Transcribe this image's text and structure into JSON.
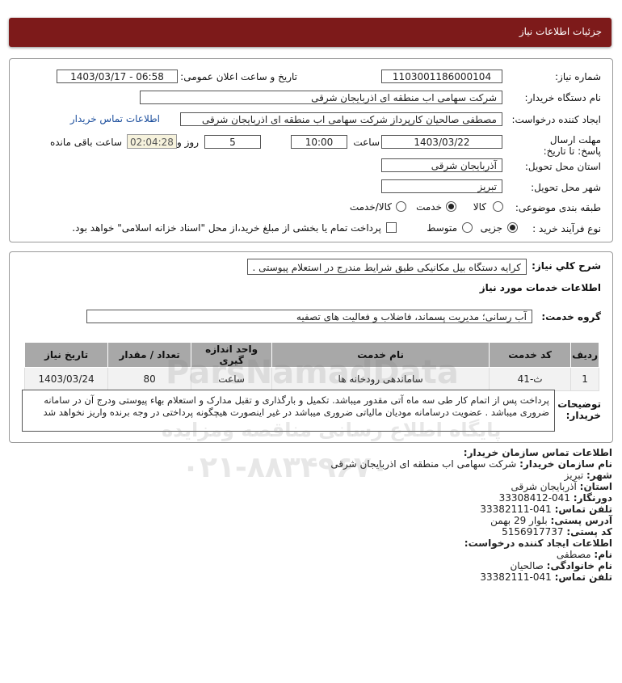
{
  "header": {
    "title": "جزئیات اطلاعات نیاز"
  },
  "form": {
    "need_number_label": "شماره نیاز:",
    "need_number": "1103001186000104",
    "announce_label": "تاریخ و ساعت اعلان عمومی:",
    "announce_value": "1403/03/17 - 06:58",
    "buyer_label": "نام دستگاه خریدار:",
    "buyer_value": "شرکت سهامی اب منطقه ای اذربایجان شرقی",
    "creator_label": "ایجاد کننده درخواست:",
    "creator_value": "مصطفی صالحیان کارپرداز شرکت سهامی اب منطقه ای اذربایجان شرقی",
    "contact_link": "اطلاعات تماس خریدار",
    "deadline_label": "مهلت ارسال پاسخ: تا تاریخ:",
    "deadline_date": "1403/03/22",
    "time_label": "ساعت",
    "deadline_time": "10:00",
    "days_value": "5",
    "days_label": "روز و",
    "remaining_time": "02:04:28",
    "remaining_label": "ساعت باقی مانده",
    "province_label": "استان محل تحویل:",
    "province_value": "آذربایجان شرقی",
    "city_label": "شهر محل تحویل:",
    "city_value": "تبریز",
    "category_label": "طبقه بندی موضوعی:",
    "category_options": [
      "کالا",
      "خدمت",
      "کالا/خدمت"
    ],
    "category_selected": "خدمت",
    "process_label": "نوع فرآیند خرید :",
    "process_options": [
      "جزیی",
      "متوسط"
    ],
    "process_selected": "جزیی",
    "payment_note": "پرداخت تمام یا بخشی از مبلغ خرید،از محل \"اسناد خزانه اسلامی\" خواهد بود."
  },
  "summary": {
    "label": "شرح کلي نياز:",
    "value": "کرایه دستگاه بیل مکانیکی طبق شرایط مندرج در استعلام پیوستی .",
    "services_title": "اطلاعات خدمات مورد نیاز",
    "group_label": "گروه خدمت:",
    "group_value": "آب رسانی؛ مدیریت پسماند، فاضلاب و فعالیت های تصفیه"
  },
  "table": {
    "headers": [
      "ردیف",
      "کد خدمت",
      "نام خدمت",
      "واحد اندازه گیری",
      "تعداد / مقدار",
      "تاریخ نیاز"
    ],
    "rows": [
      [
        "1",
        "ث-41",
        "ساماندهی رودخانه ها",
        "ساعت",
        "80",
        "1403/03/24"
      ]
    ]
  },
  "notes": {
    "label": "توضیحات خریدار:",
    "text": "پرداخت پس از اتمام کار طی سه ماه آتی مقدور میباشد. تکمیل و بارگذاری و تقبل مدارک و استعلام بهاء پیوستی ودرج آن در سامانه ضروری میباشد . عضویت درسامانه مودیان مالیاتی ضروری میباشد در غیر اینصورت هیچگونه پرداختی در وجه برنده واریز نخواهد شد"
  },
  "contact_info": {
    "title": "اطلاعات تماس سازمان خریدار:",
    "lines": [
      {
        "label": "نام سازمان خریدار:",
        "value": "شرکت سهامی اب منطقه ای اذربایجان شرقی"
      },
      {
        "label": "شهر:",
        "value": "تبریز"
      },
      {
        "label": "استان:",
        "value": "آذربایجان شرقی"
      },
      {
        "label": "دورنگار:",
        "value": "041-33308412"
      },
      {
        "label": "تلفن تماس:",
        "value": "041-33382111"
      },
      {
        "label": "آدرس پستی:",
        "value": "بلوار 29 بهمن"
      },
      {
        "label": "کد پستی:",
        "value": "5156917737"
      }
    ],
    "creator_title": "اطلاعات ایجاد کننده درخواست:",
    "creator_lines": [
      {
        "label": "نام:",
        "value": "مصطفی"
      },
      {
        "label": "نام خانوادگی:",
        "value": "صالحیان"
      },
      {
        "label": "تلفن تماس:",
        "value": "041-33382111"
      }
    ]
  },
  "watermark": {
    "site": "ParsNamadData",
    "slogan": "پایگاه اطلاع رسانی مناقصه ومزایده",
    "phone": "۰۲۱-۸۸۳۴۹۶۷۰"
  }
}
